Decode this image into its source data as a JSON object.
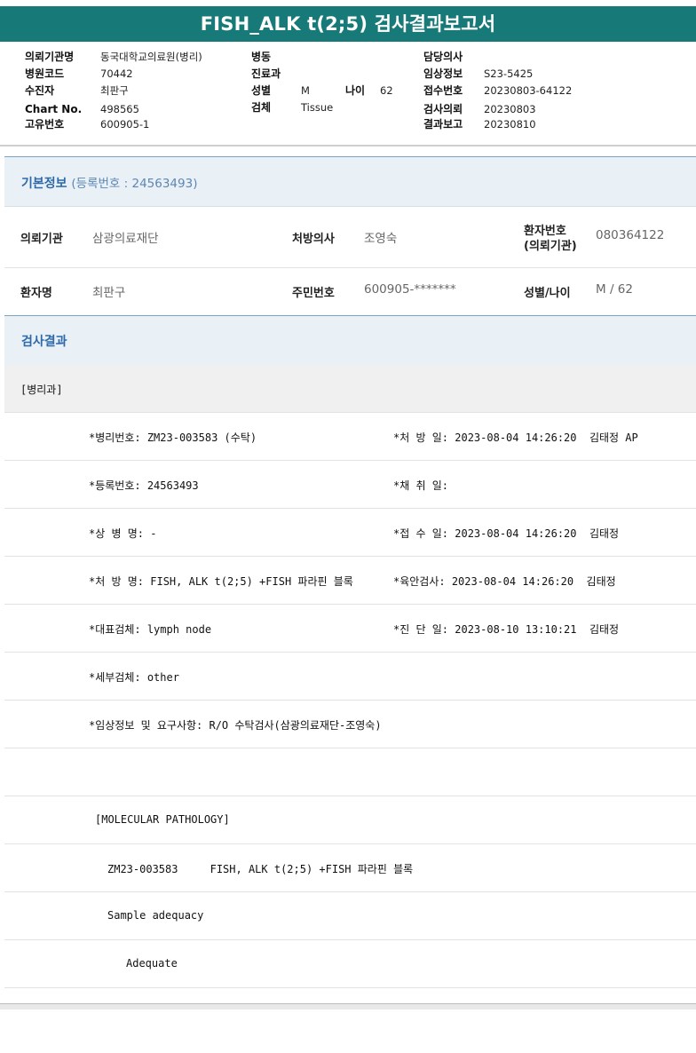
{
  "title": "FISH_ALK t(2;5) 검사결과보고서",
  "header": {
    "col1": [
      {
        "label": "의뢰기관명",
        "value": "동국대학교의료원(병리)"
      },
      {
        "label": "병원코드",
        "value": "70442"
      },
      {
        "label": "수진자",
        "value": "최판구"
      },
      {
        "label": "Chart No.",
        "value": "498565"
      },
      {
        "label": "고유번호",
        "value": "600905-1"
      }
    ],
    "col2": [
      {
        "label": "병동",
        "value": ""
      },
      {
        "label": "진료과",
        "value": ""
      },
      {
        "label": "성별",
        "value": "M"
      },
      {
        "label": "검체",
        "value": "Tissue"
      }
    ],
    "age": {
      "label": "나이",
      "value": "62"
    },
    "col3": [
      {
        "label": "담당의사",
        "value": ""
      },
      {
        "label": "임상정보",
        "value": "S23-5425"
      },
      {
        "label": "접수번호",
        "value": "20230803-64122"
      },
      {
        "label": "검사의뢰",
        "value": "20230803"
      },
      {
        "label": "결과보고",
        "value": "20230810"
      }
    ]
  },
  "basic": {
    "title": "기본정보",
    "sub": "(등록번호 : 24563493)",
    "fields": {
      "inst_label": "의뢰기관",
      "inst_value": "삼광의료재단",
      "doctor_label": "처방의사",
      "doctor_value": "조영숙",
      "pno_label": "환자번호\n(의뢰기관)",
      "pno_label1": "환자번호",
      "pno_label2": "(의뢰기관)",
      "pno_value": "080364122",
      "name_label": "환자명",
      "name_value": "최판구",
      "rrn_label": "주민번호",
      "rrn_value": "600905-*******",
      "sexage_label": "성별/나이",
      "sexage_value": "M / 62"
    }
  },
  "result": {
    "title": "검사결과",
    "dept": "[병리과]",
    "lines": [
      {
        "left": "*병리번호: ZM23-003583 (수탁)",
        "right": "*처 방 일: 2023-08-04 14:26:20  김태정 AP"
      },
      {
        "left": "*등록번호: 24563493",
        "right": "*채 취 일:"
      },
      {
        "left": "*상 병 명: -",
        "right": "*접 수 일: 2023-08-04 14:26:20  김태정"
      },
      {
        "left": "*처 방 명: FISH, ALK t(2;5) +FISH 파라핀 블록",
        "right": "*육안검사: 2023-08-04 14:26:20  김태정"
      },
      {
        "left": "*대표검체: lymph node",
        "right": "*진 단 일: 2023-08-10 13:10:21  김태정"
      },
      {
        "left": "*세부검체: other",
        "right": ""
      },
      {
        "left": "*임상정보 및 요구사항: R/O 수탁검사(삼광의료재단-조영숙)",
        "right": ""
      }
    ],
    "mol_title": "[MOLECULAR PATHOLOGY]",
    "mol_line": "ZM23-003583     FISH, ALK t(2;5) +FISH 파라핀 블록",
    "adequacy_label": "Sample adequacy",
    "adequacy_value": "Adequate"
  }
}
